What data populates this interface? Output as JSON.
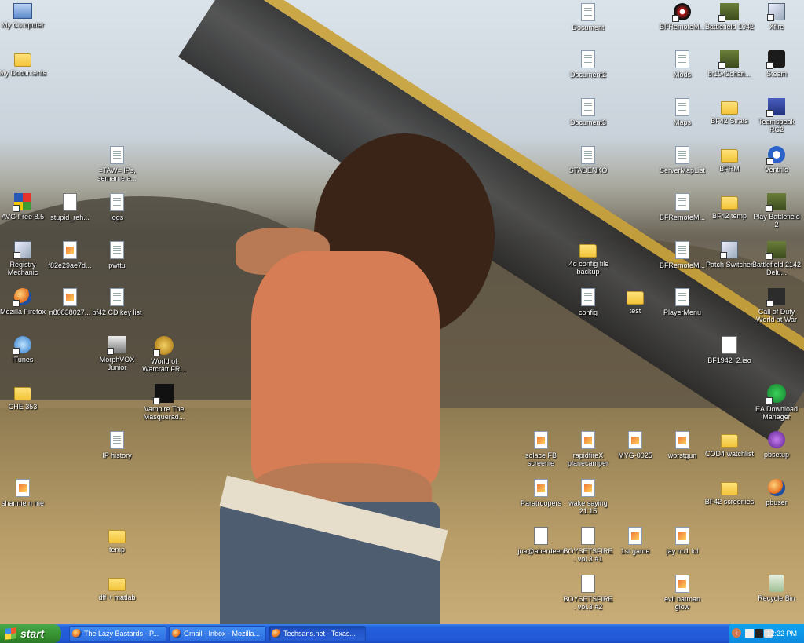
{
  "desktop": {
    "icons": [
      {
        "label": "My Computer",
        "icon": "computer-icon"
      },
      {
        "label": "My Documents",
        "icon": "folder-icon"
      },
      {
        "label": "=TAW= IPs, sername a...",
        "icon": "document-icon"
      },
      {
        "label": "AVG Free 8.5",
        "icon": "avg-icon"
      },
      {
        "label": "stupid_reh...",
        "icon": "video-icon"
      },
      {
        "label": "logs",
        "icon": "document-icon"
      },
      {
        "label": "Registry Mechanic",
        "icon": "registry-icon"
      },
      {
        "label": "f82e29ae7d...",
        "icon": "image-icon"
      },
      {
        "label": "pwttu",
        "icon": "document-icon"
      },
      {
        "label": "Mozilla Firefox",
        "icon": "firefox-icon"
      },
      {
        "label": "n80838027...",
        "icon": "image-icon"
      },
      {
        "label": "bf42 CD key list",
        "icon": "document-icon"
      },
      {
        "label": "iTunes",
        "icon": "itunes-icon"
      },
      {
        "label": "MorphVOX Junior",
        "icon": "morphvox-icon"
      },
      {
        "label": "World of Warcraft FR...",
        "icon": "wow-icon"
      },
      {
        "label": "CHE 353",
        "icon": "folder-icon"
      },
      {
        "label": "Vampire The Masquerad...",
        "icon": "vampire-icon"
      },
      {
        "label": "IP history",
        "icon": "document-icon"
      },
      {
        "label": "shannie n me",
        "icon": "image-icon"
      },
      {
        "label": "temp",
        "icon": "folder-icon"
      },
      {
        "label": "dff + matlab",
        "icon": "folder-icon"
      },
      {
        "label": "Document",
        "icon": "document-icon"
      },
      {
        "label": "BFRemoteM...",
        "icon": "bfrm-icon"
      },
      {
        "label": "Battlefield 1942",
        "icon": "battlefield-icon"
      },
      {
        "label": "Xfire",
        "icon": "xfire-icon"
      },
      {
        "label": "Document2",
        "icon": "document-icon"
      },
      {
        "label": "Mods",
        "icon": "document-icon"
      },
      {
        "label": "bf1942chan...",
        "icon": "battlefield-icon"
      },
      {
        "label": "Steam",
        "icon": "steam-icon"
      },
      {
        "label": "Document3",
        "icon": "document-icon"
      },
      {
        "label": "Maps",
        "icon": "document-icon"
      },
      {
        "label": "BF42 Strats",
        "icon": "folder-icon"
      },
      {
        "label": "Teamspeak RC2",
        "icon": "teamspeak-icon"
      },
      {
        "label": "STADENKO",
        "icon": "document-icon"
      },
      {
        "label": "ServerMapList",
        "icon": "document-icon"
      },
      {
        "label": "BFRM",
        "icon": "folder-icon"
      },
      {
        "label": "Ventrilo",
        "icon": "ventrilo-icon"
      },
      {
        "label": "BFRemoteM...",
        "icon": "document-icon"
      },
      {
        "label": "BF42 temp",
        "icon": "folder-icon"
      },
      {
        "label": "Play Battlefield 2",
        "icon": "battlefield-icon"
      },
      {
        "label": "l4d config file backup",
        "icon": "folder-icon"
      },
      {
        "label": "BFRemoteM...",
        "icon": "document-icon"
      },
      {
        "label": "Patch Switcher",
        "icon": "exe-icon"
      },
      {
        "label": "Battlefield 2142 Delu...",
        "icon": "battlefield-icon"
      },
      {
        "label": "config",
        "icon": "document-icon"
      },
      {
        "label": "test",
        "icon": "folder-icon"
      },
      {
        "label": "PlayerMenu",
        "icon": "document-icon"
      },
      {
        "label": "Call of Duty World at War",
        "icon": "cod-icon"
      },
      {
        "label": "BF1942_2.iso",
        "icon": "iso-icon"
      },
      {
        "label": "EA Download Manager",
        "icon": "ea-icon"
      },
      {
        "label": "solace FB screenie",
        "icon": "image-icon"
      },
      {
        "label": "rapidfireX planecamper",
        "icon": "image-icon"
      },
      {
        "label": "MYG-0025",
        "icon": "image-icon"
      },
      {
        "label": "worstgun",
        "icon": "image-icon"
      },
      {
        "label": "COD4 watchlist",
        "icon": "folder-icon"
      },
      {
        "label": "pbsetup",
        "icon": "pbsetup-icon"
      },
      {
        "label": "Paratroopers",
        "icon": "image-icon"
      },
      {
        "label": "wake saying 21:15",
        "icon": "image-icon"
      },
      {
        "label": "BF42 screenies",
        "icon": "folder-icon"
      },
      {
        "label": "pbuser",
        "icon": "firefox-icon"
      },
      {
        "label": "jna@aberdeen",
        "icon": "video-icon"
      },
      {
        "label": "BOYSETSFIRE. vol.3 #1",
        "icon": "video-icon"
      },
      {
        "label": "1st game",
        "icon": "image-icon"
      },
      {
        "label": "jay no1 lol",
        "icon": "image-icon"
      },
      {
        "label": "BOYSETSFIRE. vol.3 #2",
        "icon": "video-icon"
      },
      {
        "label": "evil batman glow",
        "icon": "image-icon"
      },
      {
        "label": "Recycle Bin",
        "icon": "recycle-bin-icon"
      }
    ]
  },
  "taskbar": {
    "start_label": "start",
    "tasks": [
      {
        "label": "The Lazy Bastards - P..."
      },
      {
        "label": "Gmail - Inbox - Mozilla..."
      },
      {
        "label": "Techsans.net - Texas..."
      }
    ],
    "clock": "12:22 PM",
    "tray_chevron": "‹"
  }
}
